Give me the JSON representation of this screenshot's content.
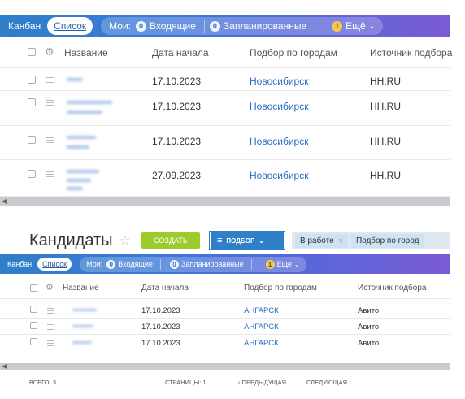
{
  "top": {
    "views": {
      "kanban": "Канбан",
      "list": "Список"
    },
    "filters": {
      "mine": "Мои:",
      "incoming": {
        "count": "0",
        "label": "Входящие"
      },
      "planned": {
        "count": "0",
        "label": "Запланированные"
      },
      "more": {
        "count": "1",
        "label": "Ещё"
      }
    },
    "columns": [
      "Название",
      "Дата начала",
      "Подбор по городам",
      "Источник подбора"
    ],
    "rows": [
      {
        "date": "17.10.2023",
        "city": "Новосибирск",
        "source": "HH.RU"
      },
      {
        "date": "17.10.2023",
        "city": "Новосибирск",
        "source": "HH.RU"
      },
      {
        "date": "17.10.2023",
        "city": "Новосибирск",
        "source": "HH.RU"
      },
      {
        "date": "27.09.2023",
        "city": "Новосибирск",
        "source": "HH.RU"
      }
    ]
  },
  "bottom": {
    "title": "Кандидаты",
    "create_button": "СОЗДАТЬ",
    "filter_button": "ПОДБОР",
    "filter_tags": [
      {
        "label": "В работе"
      },
      {
        "label": "Подбор по город"
      }
    ],
    "views": {
      "kanban": "Канбан",
      "list": "Список"
    },
    "filters": {
      "mine": "Мои:",
      "incoming": {
        "count": "0",
        "label": "Входящие"
      },
      "planned": {
        "count": "0",
        "label": "Запланированные"
      },
      "more": {
        "count": "1",
        "label": "Еще"
      }
    },
    "columns": [
      "Название",
      "Дата начала",
      "Подбор по городам",
      "Источник подбора"
    ],
    "rows": [
      {
        "date": "17.10.2023",
        "city": "АНГАРСК",
        "source": "Авито"
      },
      {
        "date": "17.10.2023",
        "city": "АНГАРСК",
        "source": "Авито"
      },
      {
        "date": "17.10.2023",
        "city": "АНГАРСК",
        "source": "Авито"
      }
    ],
    "footer": {
      "total": "ВСЕГО: 3",
      "pages": "СТРАНИЦЫ: 1",
      "prev": "‹ ПРЕДЫДУЩАЯ",
      "next": "СЛЕДУЮЩАЯ ›"
    }
  },
  "colors": {
    "accent_blue": "#3c78d8",
    "create_green": "#9ccc2b",
    "link_blue": "#2b6cc4"
  }
}
